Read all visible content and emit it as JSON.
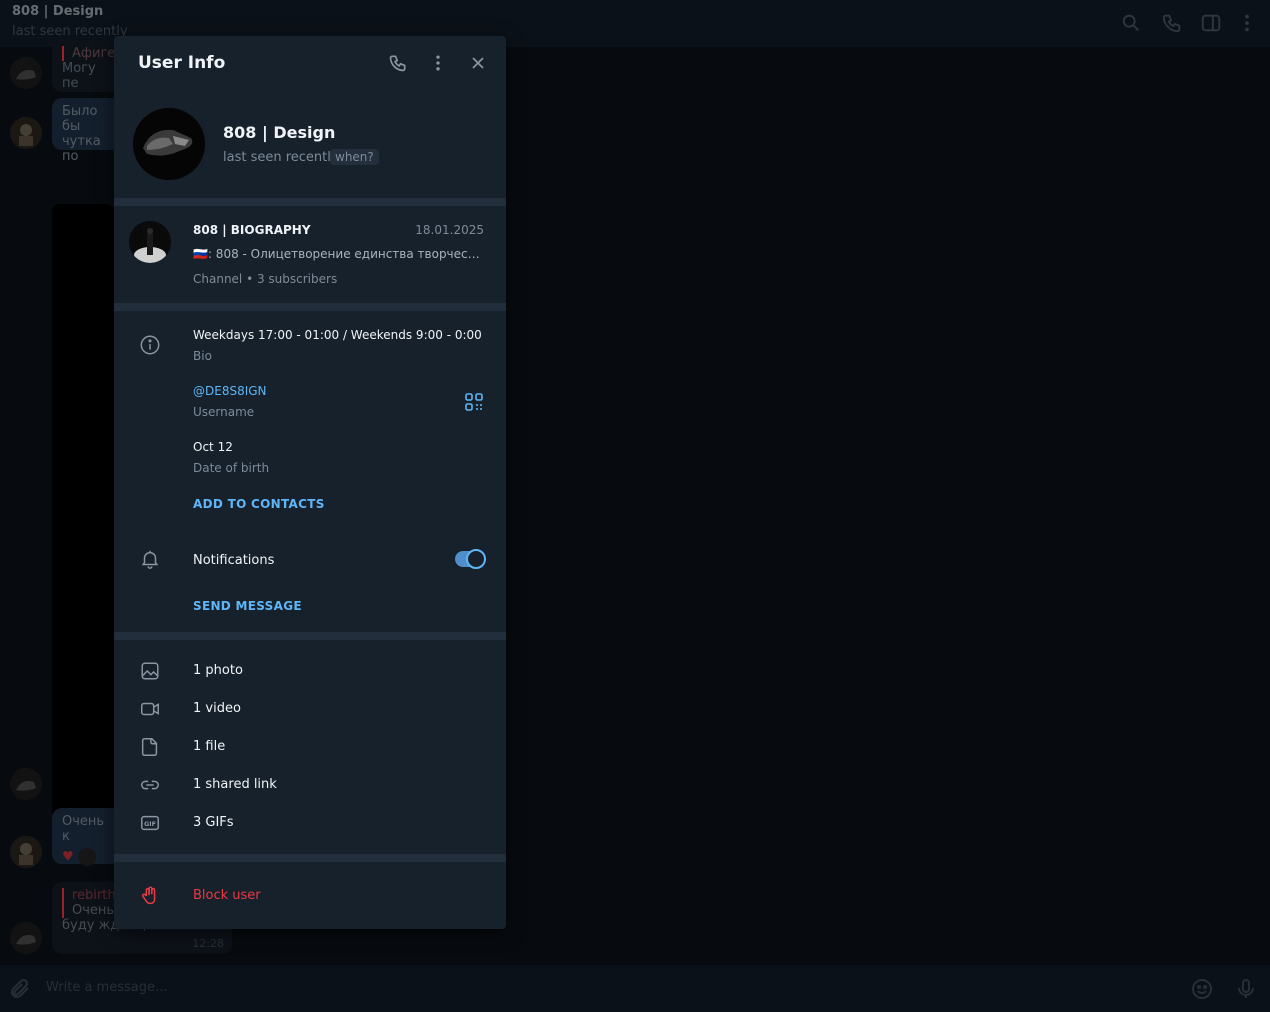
{
  "chat_header": {
    "title": "808 | Design",
    "status": "last seen recently"
  },
  "background_chat": {
    "msg1_reply": "Афиге",
    "msg1_text": "Могу пе",
    "msg2_line1": "Было бы",
    "msg2_line2": "чутка по",
    "msg3_text": "Очень к",
    "msg4_reply": "rebirth",
    "msg4_reply_text": "Очень",
    "msg4_text": "буду ждать)",
    "msg4_time": "12:28"
  },
  "composer": {
    "placeholder": "Write a message..."
  },
  "panel": {
    "title": "User Info",
    "profile": {
      "name": "808 | Design",
      "status": "last seen recently",
      "when_label": "when?"
    },
    "channel": {
      "name": "808 | BIOGRAPHY",
      "date": "18.01.2025",
      "flag": "🇷🇺",
      "preview": ": 808 - Олицетворение единства творчест...",
      "meta": "Channel • 3 subscribers"
    },
    "info": {
      "bio_value": "Weekdays 17:00 - 01:00 / Weekends 9:00 - 0:00",
      "bio_label": "Bio",
      "username_value": "@DE8S8IGN",
      "username_label": "Username",
      "birth_value": "Oct 12",
      "birth_label": "Date of birth",
      "add_contacts": "ADD TO CONTACTS",
      "notifications_label": "Notifications",
      "notifications_on": true,
      "send_message": "SEND MESSAGE"
    },
    "media": [
      {
        "label": "1 photo",
        "icon": "photo-icon"
      },
      {
        "label": "1 video",
        "icon": "video-icon"
      },
      {
        "label": "1 file",
        "icon": "file-icon"
      },
      {
        "label": "1 shared link",
        "icon": "link-icon"
      },
      {
        "label": "3 GIFs",
        "icon": "gif-icon"
      }
    ],
    "block_label": "Block user"
  },
  "colors": {
    "accent": "#5eb5f7",
    "danger": "#ec3942",
    "panel_bg": "#17212b",
    "separator": "#232e3c"
  }
}
